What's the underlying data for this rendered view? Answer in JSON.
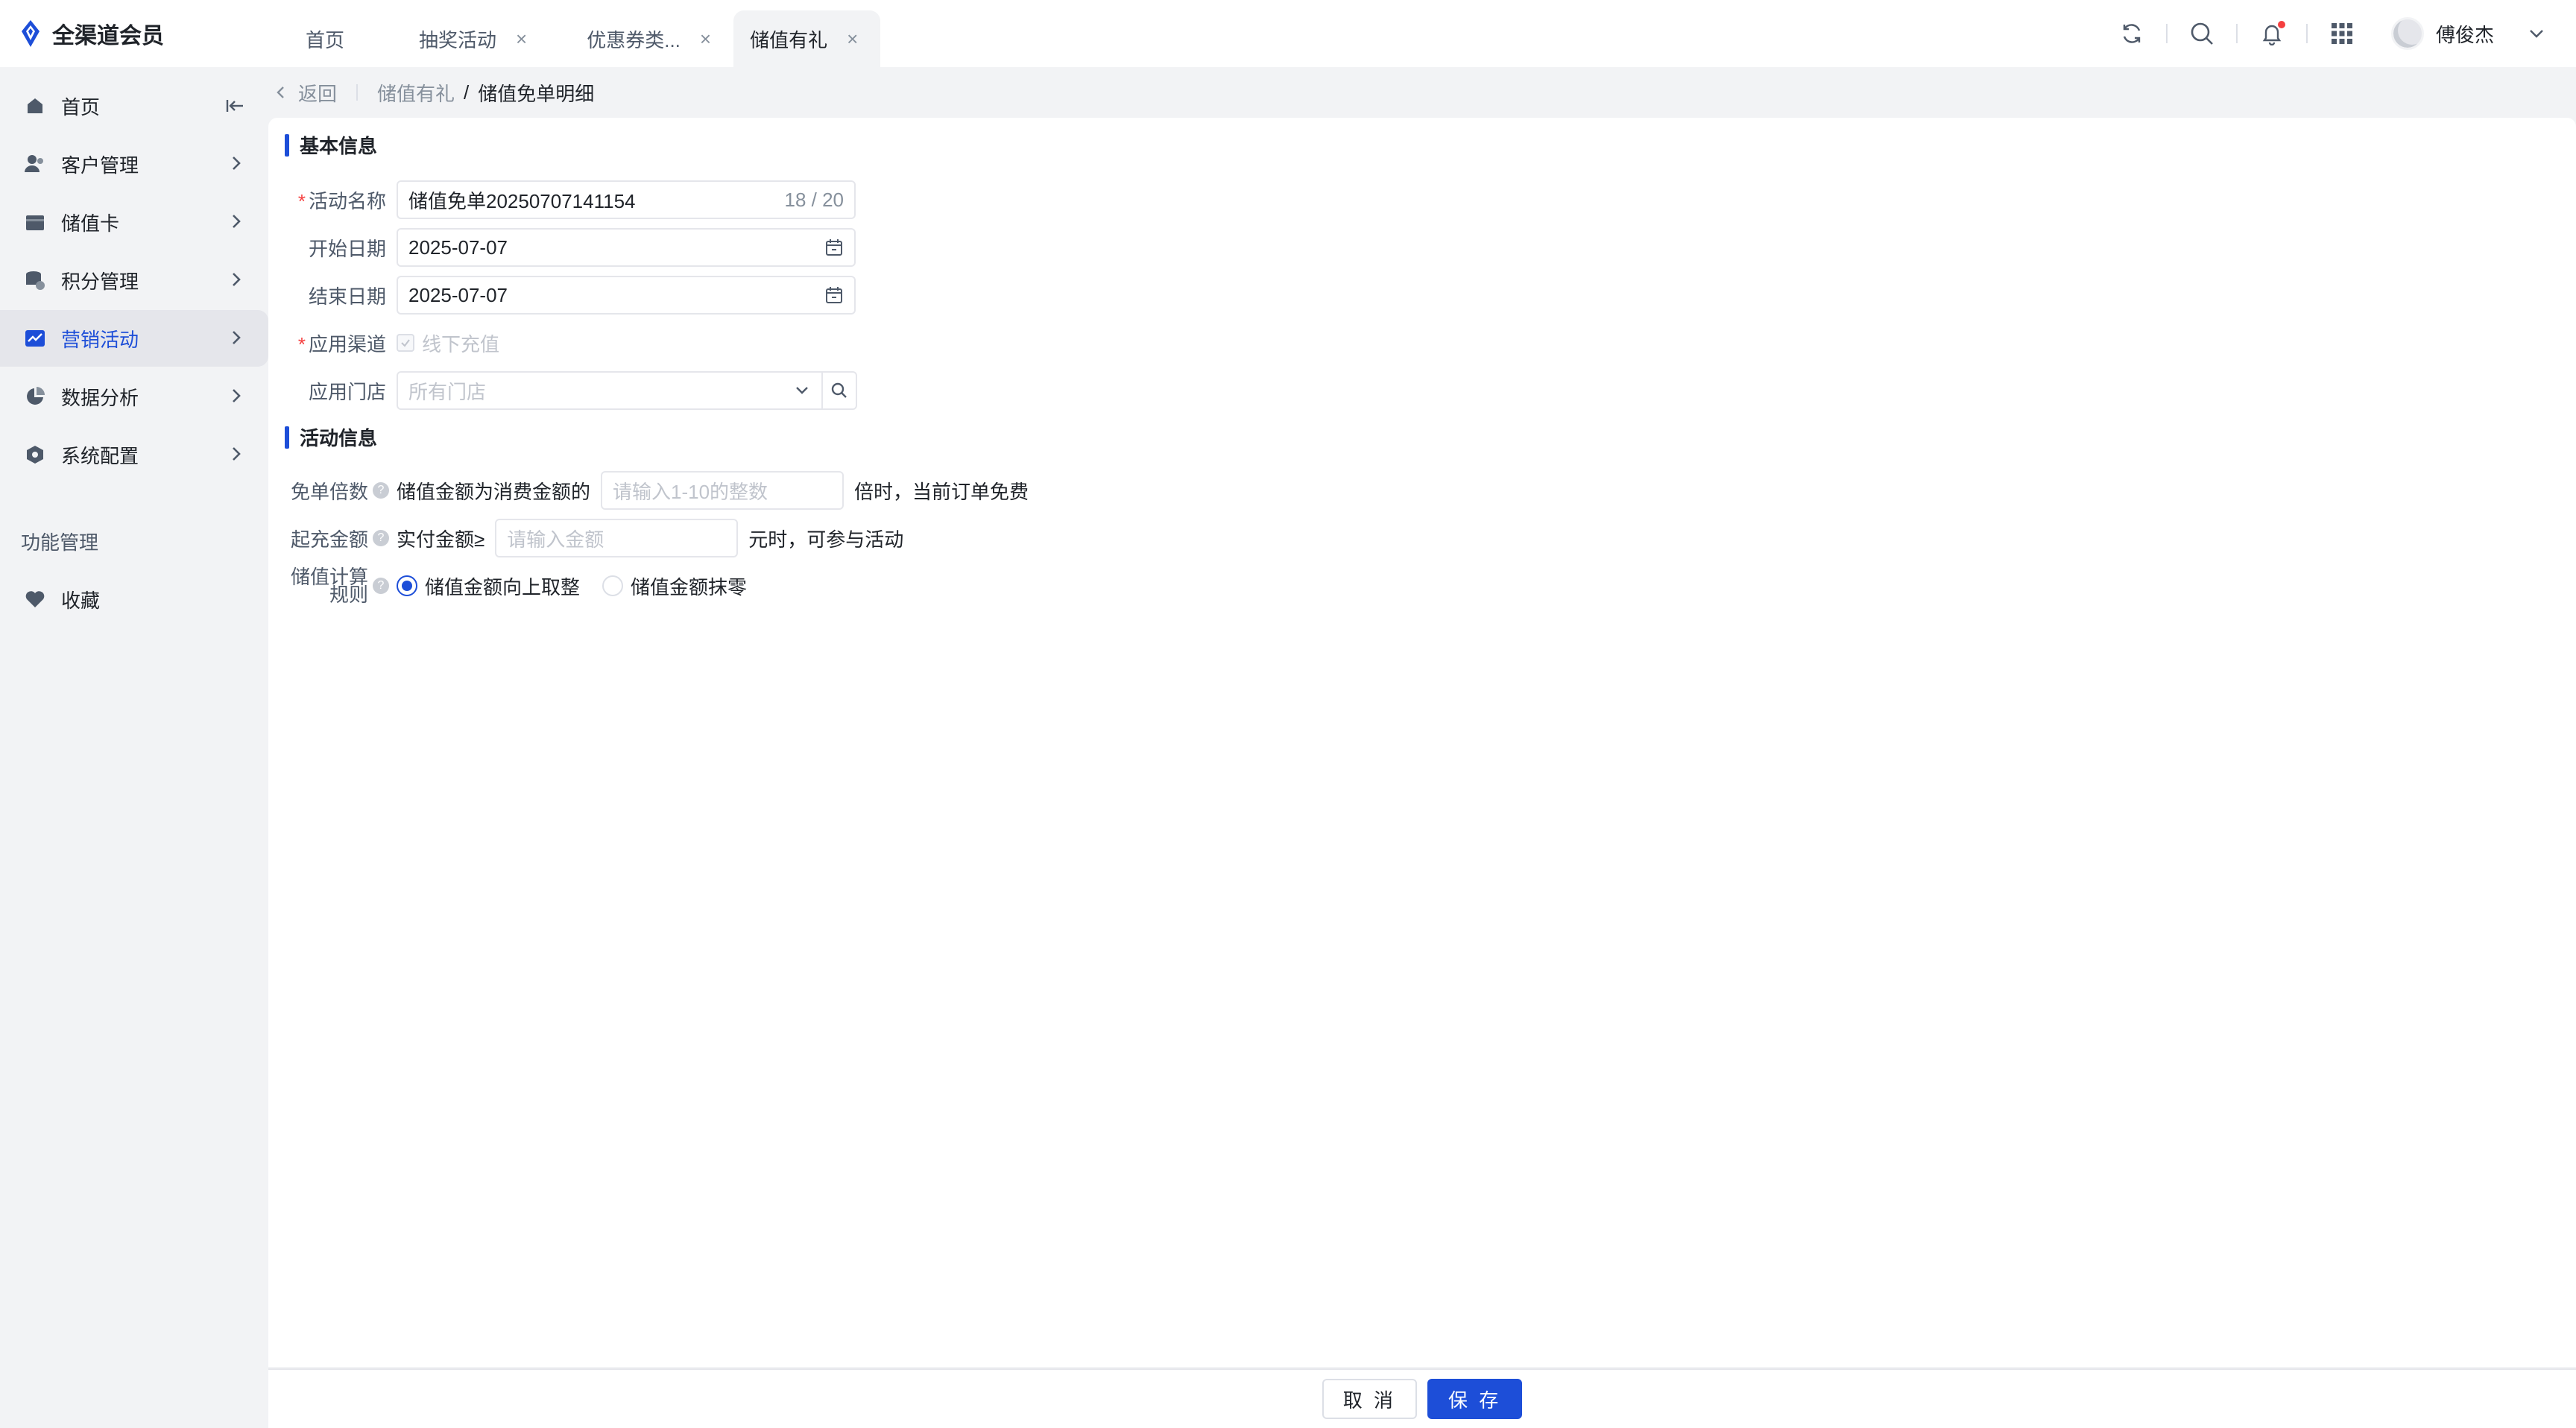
{
  "brand": {
    "name": "全渠道会员",
    "accent": "#1d4ed8"
  },
  "tabs": [
    {
      "label": "首页",
      "closable": false,
      "active": false
    },
    {
      "label": "抽奖活动",
      "closable": true,
      "active": false
    },
    {
      "label": "优惠券类...",
      "closable": true,
      "active": false
    },
    {
      "label": "储值有礼",
      "closable": true,
      "active": true
    }
  ],
  "tab_close_glyph": "×",
  "user": {
    "name": "傅俊杰"
  },
  "sidebar": {
    "items": [
      {
        "label": "首页",
        "icon": "home-icon"
      },
      {
        "label": "客户管理",
        "icon": "users-icon"
      },
      {
        "label": "储值卡",
        "icon": "card-icon"
      },
      {
        "label": "积分管理",
        "icon": "points-icon"
      },
      {
        "label": "营销活动",
        "icon": "marketing-icon",
        "active": true
      },
      {
        "label": "数据分析",
        "icon": "pie-icon"
      },
      {
        "label": "系统配置",
        "icon": "settings-icon"
      }
    ],
    "section_label": "功能管理",
    "favorite_label": "收藏"
  },
  "breadcrumb": {
    "back": "返回",
    "parent": "储值有礼",
    "sep": "/",
    "current": "储值免单明细"
  },
  "basic": {
    "title": "基本信息",
    "name_label": "活动名称",
    "name_value": "储值免单20250707141154",
    "name_count": "18 / 20",
    "start_label": "开始日期",
    "start_value": "2025-07-07",
    "end_label": "结束日期",
    "end_value": "2025-07-07",
    "channel_label": "应用渠道",
    "channel_option": "线下充值",
    "store_label": "应用门店",
    "store_placeholder": "所有门店"
  },
  "activity": {
    "title": "活动信息",
    "multiple_label": "免单倍数",
    "multiple_prefix": "储值金额为消费金额的",
    "multiple_placeholder": "请输入1-10的整数",
    "multiple_suffix": "倍时，当前订单免费",
    "min_label": "起充金额",
    "min_prefix": "实付金额≥",
    "min_placeholder": "请输入金额",
    "min_suffix": "元时，可参与活动",
    "rule_label_1": "储值计算",
    "rule_label_2": "规则",
    "rule_option_1": "储值金额向上取整",
    "rule_option_2": "储值金额抹零",
    "rule_selected": 1
  },
  "footer": {
    "cancel": "取 消",
    "save": "保 存"
  },
  "required_mark": "*",
  "help_glyph": "?"
}
